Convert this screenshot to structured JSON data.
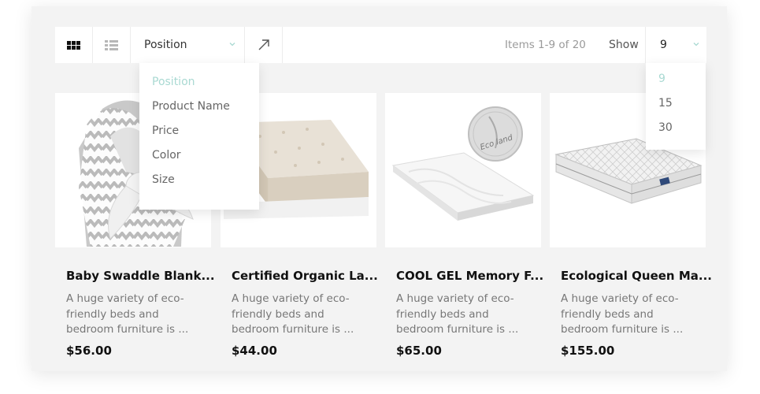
{
  "toolbar": {
    "sort_by": "Position",
    "items_count": "Items 1-9 of 20",
    "show_label": "Show",
    "limit_value": "9",
    "icons": [
      "grid-view-icon",
      "list-view-icon",
      "chevron-down-icon",
      "sort-direction-arrow-icon"
    ]
  },
  "sort_options": [
    {
      "label": "Position",
      "active": true
    },
    {
      "label": "Product Name",
      "active": false
    },
    {
      "label": "Price",
      "active": false
    },
    {
      "label": "Color",
      "active": false
    },
    {
      "label": "Size",
      "active": false
    }
  ],
  "limit_options": [
    {
      "label": "9",
      "active": true
    },
    {
      "label": "15",
      "active": false
    },
    {
      "label": "30",
      "active": false
    }
  ],
  "products": [
    {
      "title": "Baby Swaddle Blank...",
      "desc": "A huge variety of eco-friendly beds and bedroom furniture is ...",
      "price": "$56.00"
    },
    {
      "title": "Certified Organic La...",
      "desc": "A huge variety of eco-friendly beds and bedroom furniture is ...",
      "price": "$44.00"
    },
    {
      "title": "COOL GEL Memory F...",
      "desc": "A huge variety of eco-friendly beds and bedroom furniture is ...",
      "price": "$65.00",
      "badge_text": "Eco land"
    },
    {
      "title": "Ecological Queen Ma...",
      "desc": "A huge variety of eco-friendly beds and bedroom furniture is ...",
      "price": "$155.00"
    }
  ],
  "colors": {
    "active_option": "#a9d9d2",
    "panel_bg": "#f3f3f3",
    "text_dark": "#111111",
    "text_muted": "#777777"
  }
}
